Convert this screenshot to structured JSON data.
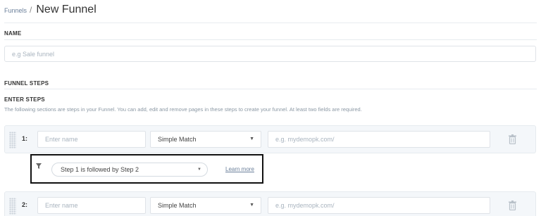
{
  "breadcrumb": {
    "parent": "Funnels",
    "separator": "/",
    "title": "New Funnel"
  },
  "name_section": {
    "label": "NAME",
    "placeholder": "e.g Sale funnel"
  },
  "steps_section": {
    "label": "FUNNEL STEPS",
    "sub_label": "ENTER STEPS",
    "help": "The following sections are steps in your Funnel. You can add, edit and remove pages in these steps to create your funnel. At least two fields are required."
  },
  "steps": [
    {
      "number": "1:",
      "name_placeholder": "Enter name",
      "match_type": "Simple Match",
      "url_placeholder": "e.g. mydemopk.com/"
    },
    {
      "number": "2:",
      "name_placeholder": "Enter name",
      "match_type": "Simple Match",
      "url_placeholder": "e.g. mydemopk.com/"
    }
  ],
  "connector": {
    "selected": "Step 1 is followed by Step 2",
    "learn_more": "Learn more"
  },
  "icons": {
    "drag": "drag-handle-icon",
    "delete": "trash-icon",
    "caret": "caret-down-icon",
    "filter": "funnel-icon"
  },
  "colors": {
    "link": "#6a7f9a",
    "row_bg": "#f4f7fa",
    "border": "#dfe3e8"
  }
}
